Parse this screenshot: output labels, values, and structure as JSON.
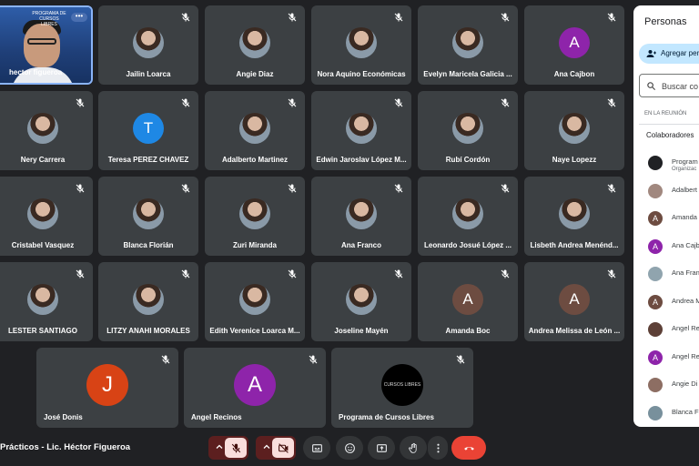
{
  "self_tile": {
    "name": "hector figueroa",
    "logo_text": "PROGRAMA DE CURSOS LIBRES",
    "menu": "•••"
  },
  "tiles": [
    {
      "name": "Jailin Loarca",
      "avatar": "photo"
    },
    {
      "name": "Angie Diaz",
      "avatar": "photo"
    },
    {
      "name": "Nora Aquino Económicas",
      "avatar": "photo"
    },
    {
      "name": "Evelyn Maricela Galicia ...",
      "avatar": "photo"
    },
    {
      "name": "Ana Cajbon",
      "avatar": "letter",
      "letter": "A",
      "color": "#8e24aa"
    },
    {
      "name": "Nery Carrera",
      "avatar": "photo"
    },
    {
      "name": "Teresa PEREZ CHAVEZ",
      "avatar": "letter",
      "letter": "T",
      "color": "#1e88e5"
    },
    {
      "name": "Adalberto Martinez",
      "avatar": "photo"
    },
    {
      "name": "Edwin Jaroslav López M...",
      "avatar": "photo"
    },
    {
      "name": "Rubí Cordón",
      "avatar": "photo"
    },
    {
      "name": "Naye Lopezz",
      "avatar": "photo"
    },
    {
      "name": "Cristabel Vasquez",
      "avatar": "photo"
    },
    {
      "name": "Blanca Florián",
      "avatar": "photo"
    },
    {
      "name": "Zuri Miranda",
      "avatar": "photo"
    },
    {
      "name": "Ana Franco",
      "avatar": "photo"
    },
    {
      "name": "Leonardo Josué López ...",
      "avatar": "photo"
    },
    {
      "name": "Lisbeth Andrea Menénd...",
      "avatar": "photo"
    },
    {
      "name": "LESTER SANTIAGO",
      "avatar": "photo"
    },
    {
      "name": "LITZY ANAHI MORALES",
      "avatar": "photo"
    },
    {
      "name": "Edith Verenice Loarca M...",
      "avatar": "photo"
    },
    {
      "name": "Joseline Mayén",
      "avatar": "photo"
    },
    {
      "name": "Amanda Boc",
      "avatar": "letter",
      "letter": "A",
      "color": "#6d4c41"
    },
    {
      "name": "Andrea Melissa de León ...",
      "avatar": "letter",
      "letter": "A",
      "color": "#6d4c41"
    }
  ],
  "bottom_tiles": [
    {
      "name": "José Donis",
      "avatar": "letter",
      "letter": "J",
      "color": "#d84315"
    },
    {
      "name": "Angel Recinos",
      "avatar": "letter",
      "letter": "A",
      "color": "#8e24aa"
    },
    {
      "name": "Programa de Cursos Libres",
      "avatar": "logo",
      "logo_text": "CURSOS LIBRES"
    }
  ],
  "people_panel": {
    "title": "Personas",
    "add_label": "Agregar per",
    "search_placeholder": "Buscar co",
    "section": "EN LA REUNIÓN",
    "collab_label": "Colaboradores",
    "list": [
      {
        "name": "Program",
        "sub": "Organizac",
        "color": "#202124",
        "letter": ""
      },
      {
        "name": "Adalbert",
        "sub": "",
        "color": "#a1887f",
        "letter": ""
      },
      {
        "name": "Amanda",
        "sub": "",
        "color": "#6d4c41",
        "letter": "A"
      },
      {
        "name": "Ana Cajb",
        "sub": "",
        "color": "#8e24aa",
        "letter": "A"
      },
      {
        "name": "Ana Fran",
        "sub": "",
        "color": "#90a4ae",
        "letter": ""
      },
      {
        "name": "Andrea M",
        "sub": "",
        "color": "#6d4c41",
        "letter": "A"
      },
      {
        "name": "Angel Re",
        "sub": "",
        "color": "#5d4037",
        "letter": ""
      },
      {
        "name": "Angel Re",
        "sub": "",
        "color": "#8e24aa",
        "letter": "A"
      },
      {
        "name": "Angie Di",
        "sub": "",
        "color": "#8d6e63",
        "letter": ""
      },
      {
        "name": "Blanca F",
        "sub": "",
        "color": "#78909c",
        "letter": ""
      }
    ]
  },
  "meeting_title": "Prácticos - Lic. Héctor Figueroa"
}
